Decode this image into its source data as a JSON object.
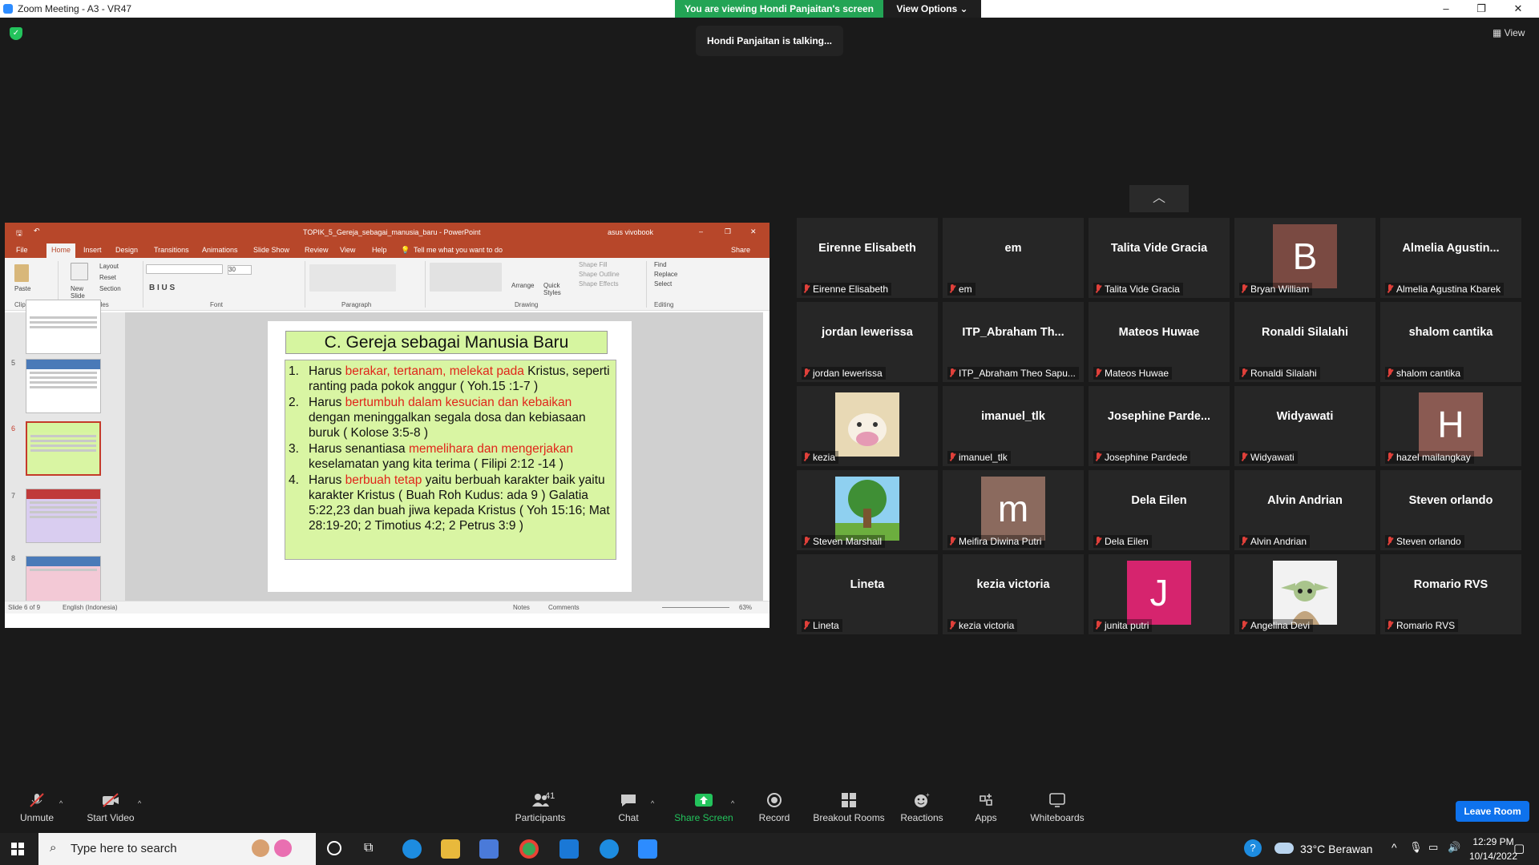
{
  "window": {
    "title": "Zoom Meeting - A3 - VR47",
    "minimize": "–",
    "maximize": "❐",
    "close": "✕"
  },
  "banner": {
    "viewing": "You are viewing Hondi Panjaitan's screen",
    "view_options": "View Options ⌄"
  },
  "talking": "Hondi Panjaitan is talking...",
  "view_button": "View",
  "ppt": {
    "title": "TOPIK_5_Gereja_sebagai_manusia_baru  -  PowerPoint",
    "account": "asus vivobook",
    "tabs": [
      "File",
      "Home",
      "Insert",
      "Design",
      "Transitions",
      "Animations",
      "Slide Show",
      "Review",
      "View",
      "Help"
    ],
    "tell_me": "Tell me what you want to do",
    "share": "Share",
    "ribbon": {
      "paste": "Paste",
      "new_slide": "New Slide",
      "layout": "Layout",
      "reset": "Reset",
      "section": "Section",
      "font_size": "30",
      "shape_fill": "Shape Fill",
      "shape_outline": "Shape Outline",
      "shape_effects": "Shape Effects",
      "arrange": "Arrange",
      "quick_styles": "Quick Styles",
      "find": "Find",
      "replace": "Replace",
      "select": "Select",
      "groups": [
        "Clipboard",
        "Slides",
        "Font",
        "Paragraph",
        "Drawing",
        "Editing"
      ]
    },
    "slide_numbers": [
      "5",
      "6",
      "7",
      "8"
    ],
    "slide": {
      "title": "C. Gereja sebagai Manusia Baru",
      "items": [
        {
          "n": "1.",
          "pre": "Harus ",
          "red": "berakar, tertanam, melekat pada",
          "post": " Kristus, seperti ranting pada pokok anggur ( Yoh.15 :1-7 )"
        },
        {
          "n": "2.",
          "pre": "Harus ",
          "red": "bertumbuh dalam kesucian dan kebaikan",
          "post": " dengan meninggalkan segala dosa dan kebiasaan buruk ( Kolose 3:5-8 )"
        },
        {
          "n": "3.",
          "pre": "Harus senantiasa ",
          "red": "memelihara dan mengerjakan",
          "post": " keselamatan yang kita terima ( Filipi 2:12 -14 )"
        },
        {
          "n": "4.",
          "pre": "Harus ",
          "red": "berbuah tetap",
          "post": " yaitu berbuah karakter baik yaitu karakter Kristus  ( Buah Roh Kudus: ada 9 ) Galatia 5:22,23 dan buah jiwa kepada Kristus ( Yoh 15:16; Mat 28:19-20; 2 Timotius 4:2; 2 Petrus 3:9 )"
        }
      ]
    },
    "status": {
      "slide": "Slide 6 of 9",
      "language": "English (Indonesia)",
      "notes": "Notes",
      "comments": "Comments",
      "zoom": "63%"
    }
  },
  "participants": [
    {
      "display": "Eirenne Elisabeth",
      "name": "Eirenne Elisabeth"
    },
    {
      "display": "em",
      "name": "em"
    },
    {
      "display": "Talita Vide Gracia",
      "name": "Talita Vide Gracia"
    },
    {
      "display": "B",
      "name": "Bryan William",
      "avatar_color": "#7a4a42"
    },
    {
      "display": "Almelia  Agustin...",
      "name": "Almelia Agustina Kbarek"
    },
    {
      "display": "jordan lewerissa",
      "name": "jordan lewerissa"
    },
    {
      "display": "ITP_Abraham  Th...",
      "name": "ITP_Abraham Theo Sapu..."
    },
    {
      "display": "Mateos Huwae",
      "name": "Mateos Huwae"
    },
    {
      "display": "Ronaldi Silalahi",
      "name": "Ronaldi Silalahi"
    },
    {
      "display": "shalom cantika",
      "name": "shalom cantika"
    },
    {
      "display": "",
      "name": "kezia",
      "picture": "hamster"
    },
    {
      "display": "imanuel_tlk",
      "name": "imanuel_tlk"
    },
    {
      "display": "Josephine  Parde...",
      "name": "Josephine Pardede"
    },
    {
      "display": "Widyawati",
      "name": "Widyawati"
    },
    {
      "display": "H",
      "name": "hazel mailangkay",
      "avatar_color": "#8a5a52"
    },
    {
      "display": "",
      "name": "Steven Marshall",
      "picture": "tree"
    },
    {
      "display": "m",
      "name": "Meifira Diwina Putri",
      "avatar_color": "#8b6a5e"
    },
    {
      "display": "Dela Eilen",
      "name": "Dela Eilen"
    },
    {
      "display": "Alvin Andrian",
      "name": "Alvin Andrian"
    },
    {
      "display": "Steven orlando",
      "name": "Steven orlando"
    },
    {
      "display": "Lineta",
      "name": "Lineta"
    },
    {
      "display": "kezia victoria",
      "name": "kezia victoria"
    },
    {
      "display": "J",
      "name": "junita putri",
      "avatar_color": "#d6246e"
    },
    {
      "display": "",
      "name": "Angelina Devi",
      "picture": "yoda"
    },
    {
      "display": "Romario RVS",
      "name": "Romario RVS"
    }
  ],
  "toolbar": {
    "unmute": "Unmute",
    "start_video": "Start Video",
    "participants": "Participants",
    "participant_count": "41",
    "chat": "Chat",
    "share_screen": "Share Screen",
    "record": "Record",
    "breakout": "Breakout Rooms",
    "reactions": "Reactions",
    "apps": "Apps",
    "whiteboards": "Whiteboards",
    "leave": "Leave Room",
    "share_color": "#23c35c",
    "leave_color": "#0e72ed"
  },
  "taskbar": {
    "search_placeholder": "Type here to search",
    "weather": "33°C  Berawan",
    "time": "12:29 PM",
    "date": "10/14/2022"
  }
}
